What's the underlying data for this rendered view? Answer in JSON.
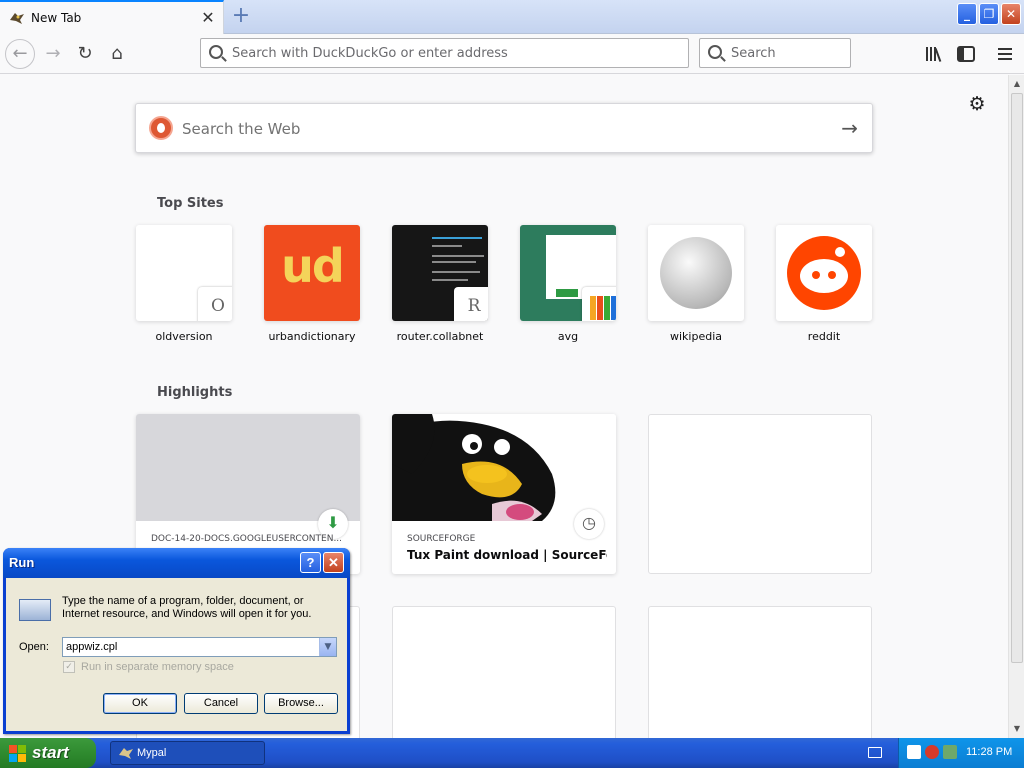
{
  "browser": {
    "tab": {
      "title": "New Tab",
      "close": "✕",
      "new": "+"
    },
    "window_buttons": {
      "minimize": "_",
      "restore": "❐",
      "close": "✕"
    },
    "nav": {
      "back": "←",
      "forward": "→",
      "reload": "↻",
      "home": "⌂"
    },
    "urlbar": {
      "placeholder": "Search with DuckDuckGo or enter address",
      "value": ""
    },
    "searchbar": {
      "placeholder": "Search"
    },
    "icons": {
      "library": "library-icon",
      "sidebar": "sidebar-icon",
      "menu": "hamburger-menu-icon"
    }
  },
  "newtab": {
    "settings_icon": "⚙",
    "web_search": {
      "placeholder": "Search the Web",
      "go": "→"
    },
    "top_sites_title": "Top Sites",
    "top_sites": [
      {
        "label": "oldversion",
        "badge": "O"
      },
      {
        "label": "urbandictionary",
        "logo_text": "ud"
      },
      {
        "label": "router.collabnet",
        "badge": "R"
      },
      {
        "label": "avg"
      },
      {
        "label": "wikipedia"
      },
      {
        "label": "reddit"
      }
    ],
    "highlights_title": "Highlights",
    "highlights": [
      {
        "host": "DOC-14-20-DOCS.GOOGLEUSERCONTEN...",
        "title": "",
        "icon": "⬇"
      },
      {
        "host": "SOURCEFORGE",
        "title": "Tux Paint download | SourceFor...",
        "icon": "◷"
      }
    ]
  },
  "run_dialog": {
    "title": "Run",
    "help": "?",
    "close": "✕",
    "description": "Type the name of a program, folder, document, or Internet resource, and Windows will open it for you.",
    "open_label": "Open:",
    "open_value": "appwiz.cpl",
    "combo_arrow": "▼",
    "checkbox_mark": "✓",
    "checkbox_label": "Run in separate memory space",
    "ok": "OK",
    "cancel": "Cancel",
    "browse": "Browse..."
  },
  "taskbar": {
    "start": "start",
    "task": "Mypal",
    "time": "11:28 PM"
  },
  "colors": {
    "accent": "#0a84ff",
    "xp_blue": "#245edb",
    "xp_green": "#2f8b2f",
    "reddit": "#ff4500",
    "ddg": "#de5833"
  }
}
